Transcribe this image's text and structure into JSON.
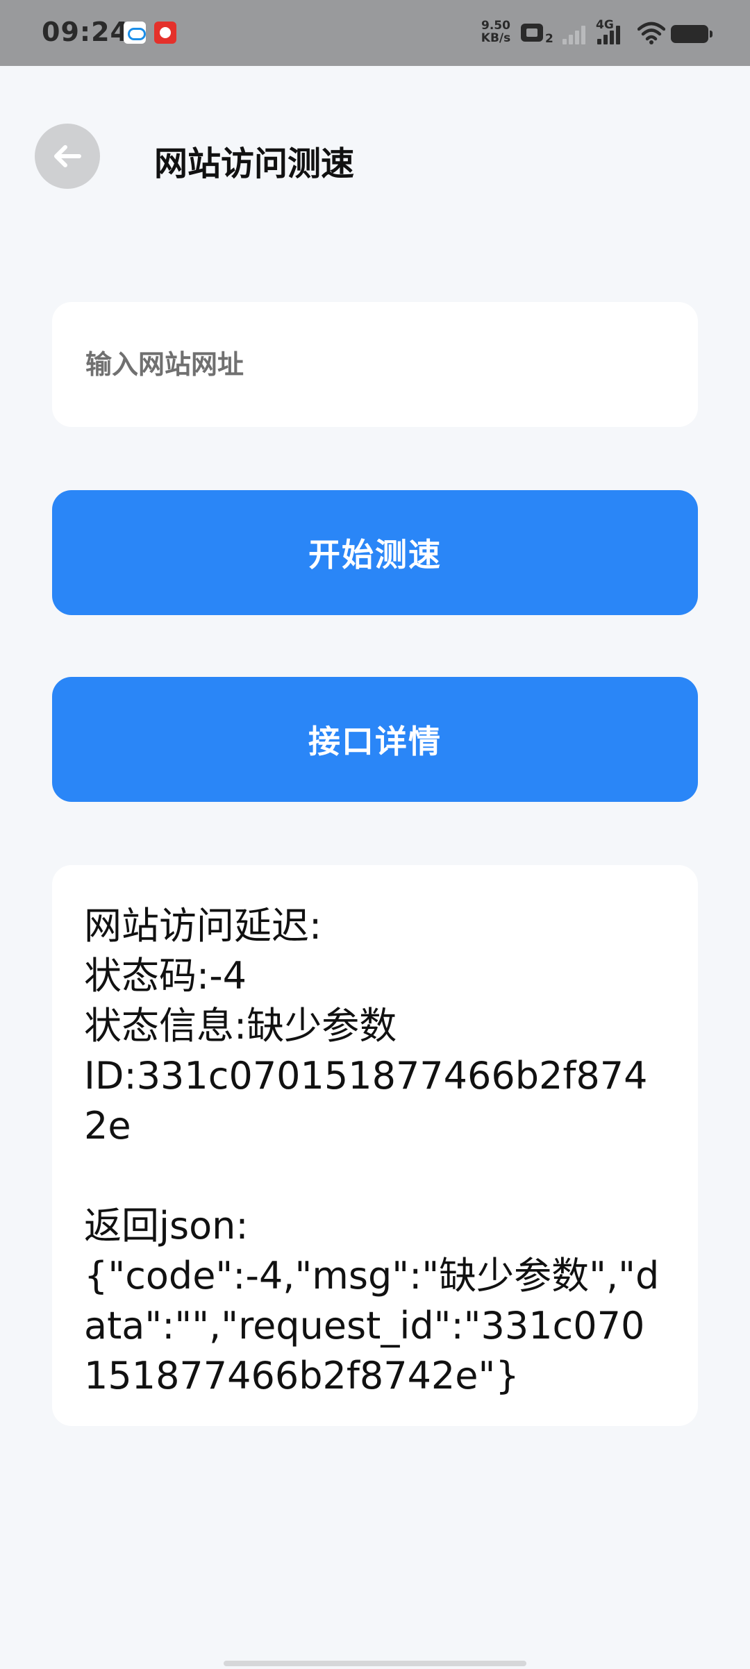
{
  "status_bar": {
    "time": "09:24",
    "net_speed_value": "9.50",
    "net_speed_unit": "KB/s",
    "hd_label": "2",
    "network_type": "4G"
  },
  "header": {
    "title": "网站访问测速"
  },
  "form": {
    "url_placeholder": "输入网站网址",
    "url_value": ""
  },
  "buttons": {
    "start_label": "开始测速",
    "detail_label": "接口详情"
  },
  "result": {
    "text": "网站访问延迟:\n状态码:-4\n状态信息:缺少参数\nID:331c070151877466b2f8742e\n\n返回json:\n{\"code\":-4,\"msg\":\"缺少参数\",\"data\":\"\",\"request_id\":\"331c070151877466b2f8742e\"}"
  },
  "colors": {
    "accent": "#2a86f7",
    "background": "#f5f7fa",
    "card": "#ffffff",
    "status_bar": "#999a9c"
  }
}
